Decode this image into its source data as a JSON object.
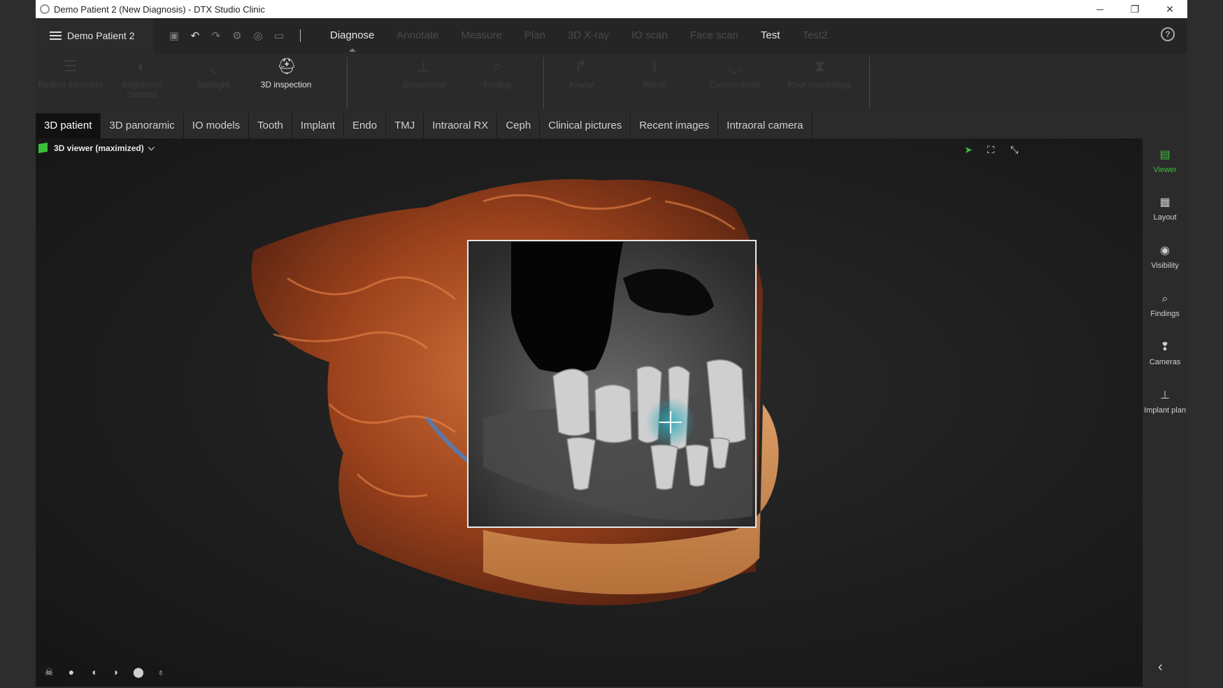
{
  "window": {
    "title": "Demo Patient 2 (New Diagnosis) - DTX Studio Clinic",
    "controls": {
      "minimize": "─",
      "restore": "❐",
      "close": "✕"
    }
  },
  "header": {
    "patient_name": "Demo Patient 2",
    "modes": [
      {
        "label": "Diagnose",
        "state": "active"
      },
      {
        "label": "Annotate",
        "state": "disabled"
      },
      {
        "label": "Measure",
        "state": "disabled"
      },
      {
        "label": "Plan",
        "state": "disabled"
      },
      {
        "label": "3D X-ray",
        "state": "disabled"
      },
      {
        "label": "IO scan",
        "state": "disabled"
      },
      {
        "label": "Face scan",
        "state": "disabled"
      },
      {
        "label": "Test",
        "state": "enabled"
      },
      {
        "label": "Test2",
        "state": "disabled"
      }
    ],
    "help": "?"
  },
  "ribbon": {
    "tools": [
      {
        "label": "Realize thickness",
        "icon": "layers-icon",
        "enabled": false
      },
      {
        "label": "Brightness contrast",
        "icon": "contrast-icon",
        "enabled": false
      },
      {
        "label": "Spotlight",
        "icon": "spotlight-icon",
        "enabled": false
      },
      {
        "label": "3D inspection",
        "icon": "inspection-icon",
        "enabled": true
      },
      {
        "label": "Screenshot",
        "icon": "screenshot-icon",
        "enabled": false
      },
      {
        "label": "Finding",
        "icon": "finding-icon",
        "enabled": false
      },
      {
        "label": "Airway",
        "icon": "airway-icon",
        "enabled": false
      },
      {
        "label": "Nerve",
        "icon": "nerve-icon",
        "enabled": false
      },
      {
        "label": "Custom smile",
        "icon": "smile-icon",
        "enabled": false
      },
      {
        "label": "Root morphology",
        "icon": "root-icon",
        "enabled": false
      }
    ]
  },
  "data_tabs": [
    {
      "label": "3D patient",
      "active": true
    },
    {
      "label": "3D panoramic",
      "active": false
    },
    {
      "label": "IO models",
      "active": false
    },
    {
      "label": "Tooth",
      "active": false
    },
    {
      "label": "Implant",
      "active": false
    },
    {
      "label": "Endo",
      "active": false
    },
    {
      "label": "TMJ",
      "active": false
    },
    {
      "label": "Intraoral RX",
      "active": false
    },
    {
      "label": "Ceph",
      "active": false
    },
    {
      "label": "Clinical pictures",
      "active": false
    },
    {
      "label": "Recent images",
      "active": false
    },
    {
      "label": "Intraoral camera",
      "active": false
    }
  ],
  "viewer": {
    "label": "3D viewer (maximized)"
  },
  "sidebar": {
    "items": [
      {
        "label": "Viewer",
        "icon": "viewer-icon",
        "active": true
      },
      {
        "label": "Layout",
        "icon": "layout-icon",
        "active": false
      },
      {
        "label": "Visibility",
        "icon": "eye-icon",
        "active": false
      },
      {
        "label": "Findings",
        "icon": "findings-icon",
        "active": false
      },
      {
        "label": "Cameras",
        "icon": "camera-icon",
        "active": false
      },
      {
        "label": "Implant plan",
        "icon": "implant-icon",
        "active": false
      }
    ]
  },
  "colors": {
    "accent": "#3bbf3b",
    "bone": "#c8642e",
    "highlight": "#2aa9b8"
  }
}
